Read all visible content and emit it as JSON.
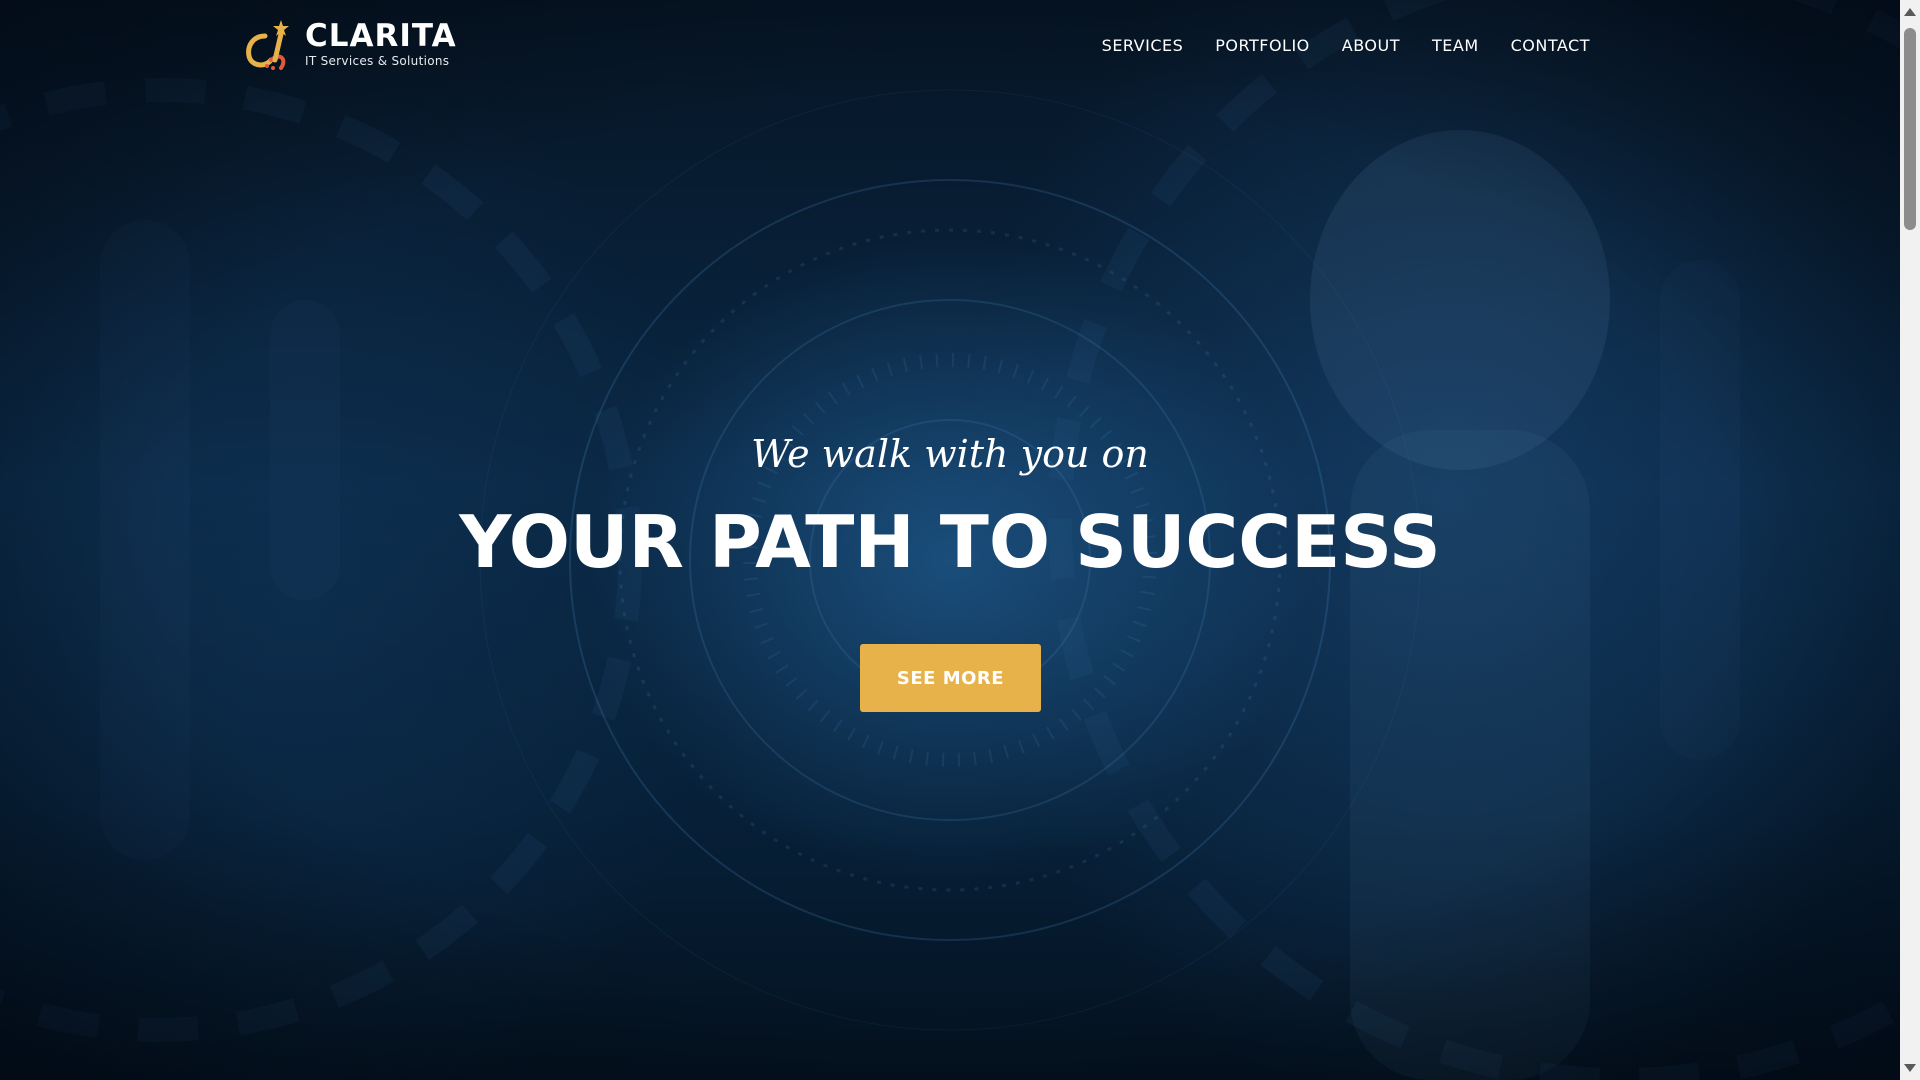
{
  "header": {
    "logo_title": "CLARITA",
    "logo_subtitle": "IT Services & Solutions"
  },
  "nav": {
    "items": [
      {
        "label": "SERVICES"
      },
      {
        "label": "PORTFOLIO"
      },
      {
        "label": "ABOUT"
      },
      {
        "label": "TEAM"
      },
      {
        "label": "CONTACT"
      }
    ]
  },
  "hero": {
    "tagline": "We walk with you on",
    "headline": "YOUR PATH TO SUCCESS",
    "cta_label": "SEE MORE"
  },
  "colors": {
    "accent": "#e8b24a",
    "background": "#0a2845",
    "text": "#ffffff"
  },
  "icons": {
    "logo": "clarita-logo-icon"
  }
}
